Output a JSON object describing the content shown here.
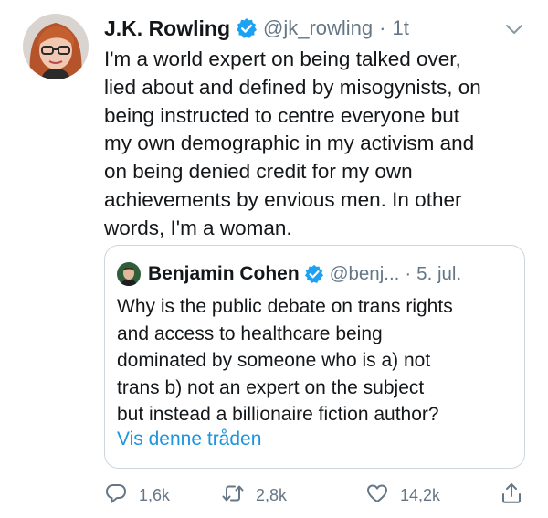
{
  "tweet": {
    "author": {
      "name": "J.K. Rowling",
      "handle": "@jk_rowling",
      "separator": "·",
      "time": "1t",
      "verified": true
    },
    "text_lines": [
      "I'm a world expert on being talked over,",
      "lied about and defined by misogynists, on",
      "being instructed to centre everyone but",
      "my own demographic in my activism and",
      "on being denied credit for my own",
      "achievements by envious men. In other",
      "words, I'm a woman."
    ],
    "quoted": {
      "author": {
        "name": "Benjamin Cohen",
        "handle": "@benj...",
        "separator": "·",
        "time": "5. jul.",
        "verified": true
      },
      "text_lines": [
        "Why is the public debate on trans rights",
        "and access to healthcare being",
        "dominated by someone who is a) not",
        "trans b) not an expert on the subject",
        "but instead a billionaire fiction author?"
      ],
      "thread_link": "Vis denne tråden"
    },
    "actions": {
      "replies": "1,6k",
      "retweets": "2,8k",
      "likes": "14,2k"
    }
  },
  "icons": {
    "verified": "verified-badge-icon",
    "caret": "chevron-down-icon",
    "reply": "reply-icon",
    "retweet": "retweet-icon",
    "like": "heart-icon",
    "share": "share-icon"
  },
  "colors": {
    "text": "#14171a",
    "secondary": "#657786",
    "link": "#1b95e0",
    "verified": "#1da1f2",
    "border": "#cdd6dd"
  }
}
